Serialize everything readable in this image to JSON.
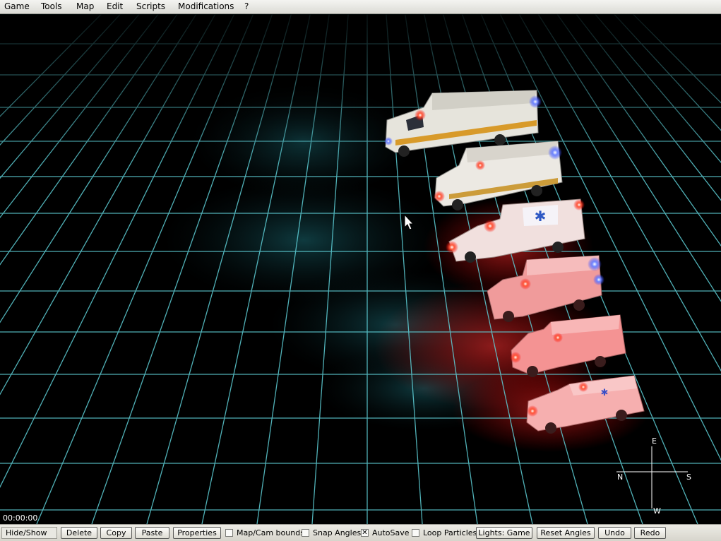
{
  "menu": [
    {
      "label": "Game"
    },
    {
      "label": "Tools"
    },
    {
      "label": "Map"
    },
    {
      "label": "Edit"
    },
    {
      "label": "Scripts"
    },
    {
      "label": "Modifications"
    },
    {
      "label": "?"
    }
  ],
  "compass": {
    "north": "N",
    "east": "E",
    "south": "S",
    "west": "W"
  },
  "timer": "00:00:00",
  "toolbar": {
    "hide_show": "Hide/Show",
    "delete": "Delete",
    "copy": "Copy",
    "paste": "Paste",
    "properties": "Properties",
    "map_cam_bounds": {
      "label": "Map/Cam bounds",
      "checked": false
    },
    "snap_angles": {
      "label": "Snap Angles",
      "checked": false
    },
    "autosave": {
      "label": "AutoSave",
      "checked": true
    },
    "loop_particles": {
      "label": "Loop Particles",
      "checked": false
    },
    "lights": "Lights: Game",
    "reset_angles": "Reset Angles",
    "undo": "Undo",
    "redo": "Redo"
  },
  "scene": {
    "grid_color": "#4fc3cc",
    "vehicles": [
      {
        "name": "ambulance-1",
        "body_color": "#e8e6df",
        "tint": "none"
      },
      {
        "name": "ambulance-2",
        "body_color": "#ece9e4",
        "tint": "light-red"
      },
      {
        "name": "ambulance-3",
        "body_color": "#f1dede",
        "tint": "red"
      },
      {
        "name": "ambulance-4",
        "body_color": "#f2a7a7",
        "tint": "red"
      },
      {
        "name": "ambulance-5",
        "body_color": "#f59c9c",
        "tint": "red"
      },
      {
        "name": "suv-supervisor",
        "body_color": "#f7b1b1",
        "tint": "red"
      }
    ]
  }
}
